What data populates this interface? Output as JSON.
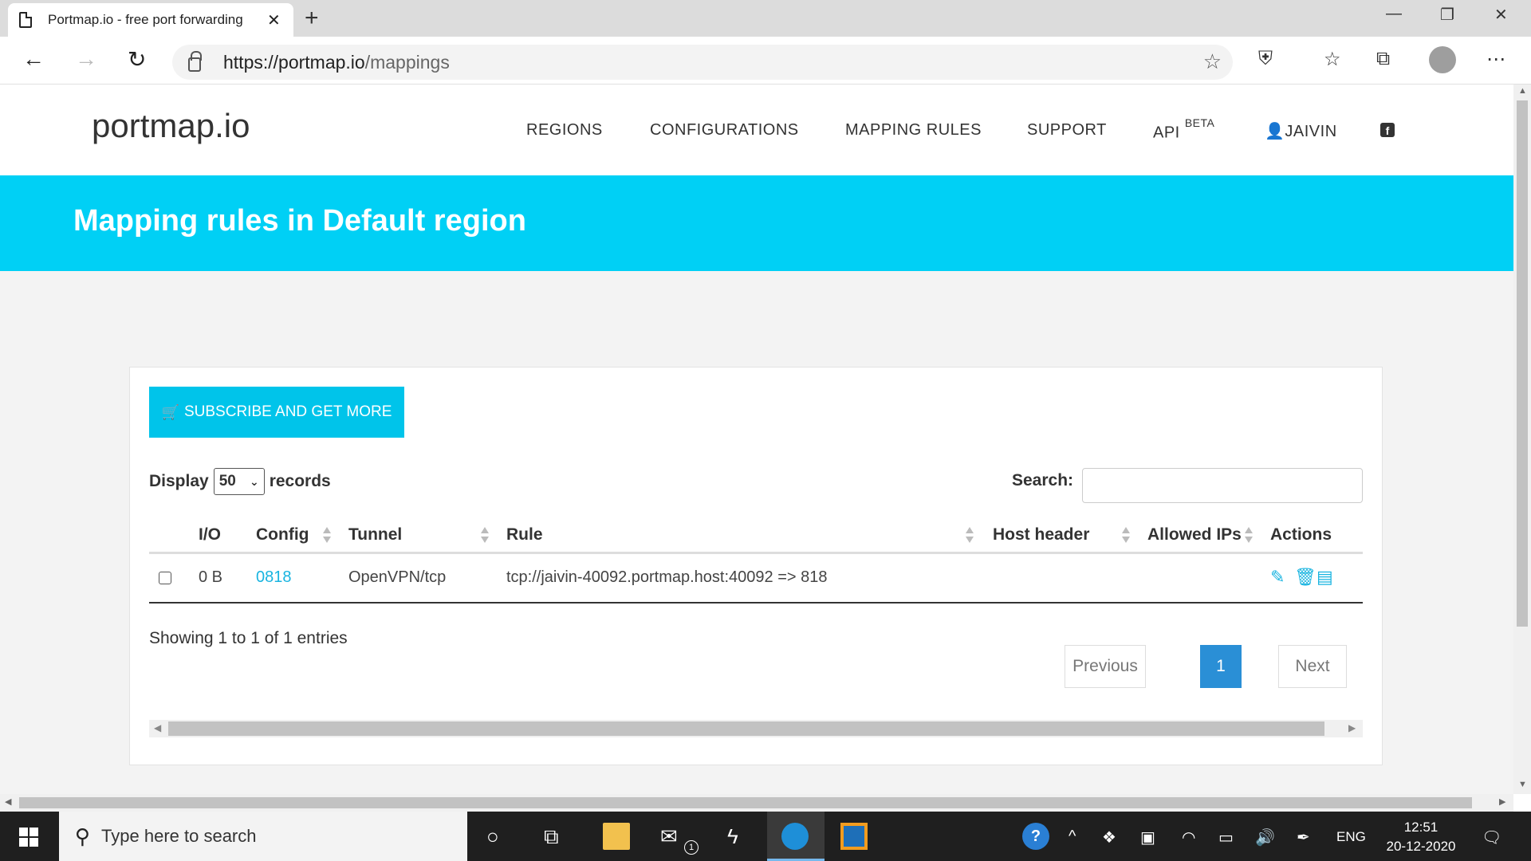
{
  "browser": {
    "tab_title": "Portmap.io - free port forwarding",
    "new_tab": "+",
    "url_host": "https://portmap.io",
    "url_path": "/mappings"
  },
  "site": {
    "brand": "portmap.io",
    "nav": {
      "regions": "REGIONS",
      "configurations": "CONFIGURATIONS",
      "mapping_rules": "MAPPING RULES",
      "support": "SUPPORT",
      "api": "API",
      "api_badge": "BETA",
      "user": "JAIVIN"
    },
    "banner_title": "Mapping rules in Default region"
  },
  "content": {
    "subscribe_label": "SUBSCRIBE AND GET MORE",
    "display_label": "Display",
    "records_value": "50",
    "records_label": "records",
    "search_label": "Search:",
    "search_value": "",
    "columns": {
      "io": "I/O",
      "config": "Config",
      "tunnel": "Tunnel",
      "rule": "Rule",
      "host_header": "Host header",
      "allowed_ips": "Allowed IPs",
      "actions": "Actions"
    },
    "rows": [
      {
        "io": "0 B",
        "config": "0818",
        "tunnel": "OpenVPN/tcp",
        "rule": "tcp://jaivin-40092.portmap.host:40092 => 818",
        "host_header": "",
        "allowed_ips": ""
      }
    ],
    "showing": "Showing 1 to 1 of 1 entries",
    "pagination": {
      "previous": "Previous",
      "current": "1",
      "next": "Next"
    }
  },
  "taskbar": {
    "search_placeholder": "Type here to search",
    "mail_badge": "1",
    "language": "ENG",
    "time": "12:51",
    "date": "20-12-2020"
  },
  "colors": {
    "banner": "#00d0f5",
    "accent": "#19b4e0",
    "page_active": "#2a8fd6"
  }
}
